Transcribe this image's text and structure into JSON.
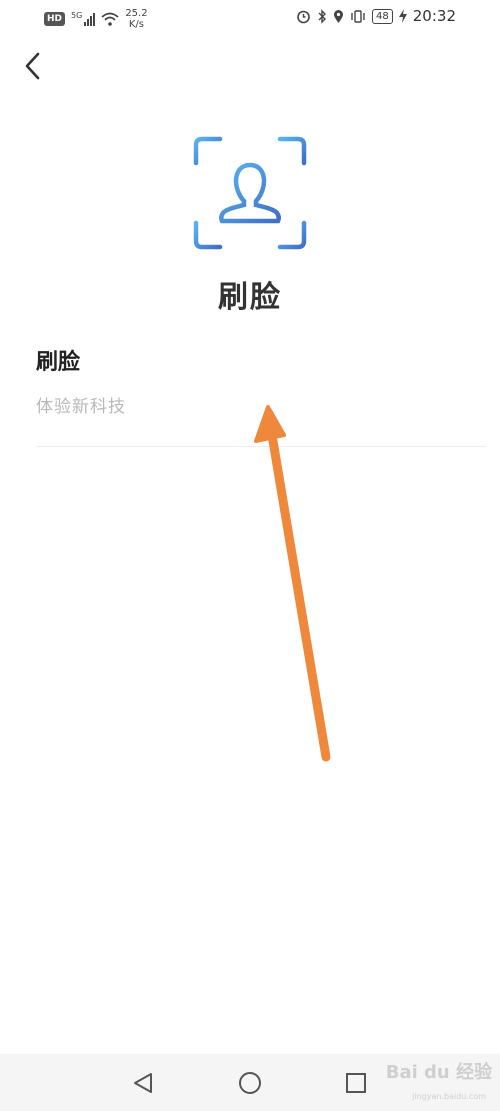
{
  "status_bar": {
    "hd": "HD",
    "network": "5G",
    "speed_value": "25.2",
    "speed_unit": "K/s",
    "battery": "48",
    "time": "20:32"
  },
  "header": {
    "back_icon": "chevron-left-icon"
  },
  "hero": {
    "title": "刷脸",
    "icon": "face-scan-icon"
  },
  "section": {
    "title": "刷脸",
    "subtitle": "体验新科技"
  },
  "annotation": {
    "type": "arrow",
    "color": "#f0883c"
  },
  "navbar": {
    "back": "triangle-back-icon",
    "home": "circle-home-icon",
    "recents": "square-recents-icon"
  },
  "watermark": {
    "text": "Bai du 经验",
    "sub": "jingyan.baidu.com"
  },
  "colors": {
    "icon_gradient_start": "#5ab4ec",
    "icon_gradient_end": "#3f6fc8",
    "subtitle": "#b8b8b8"
  }
}
